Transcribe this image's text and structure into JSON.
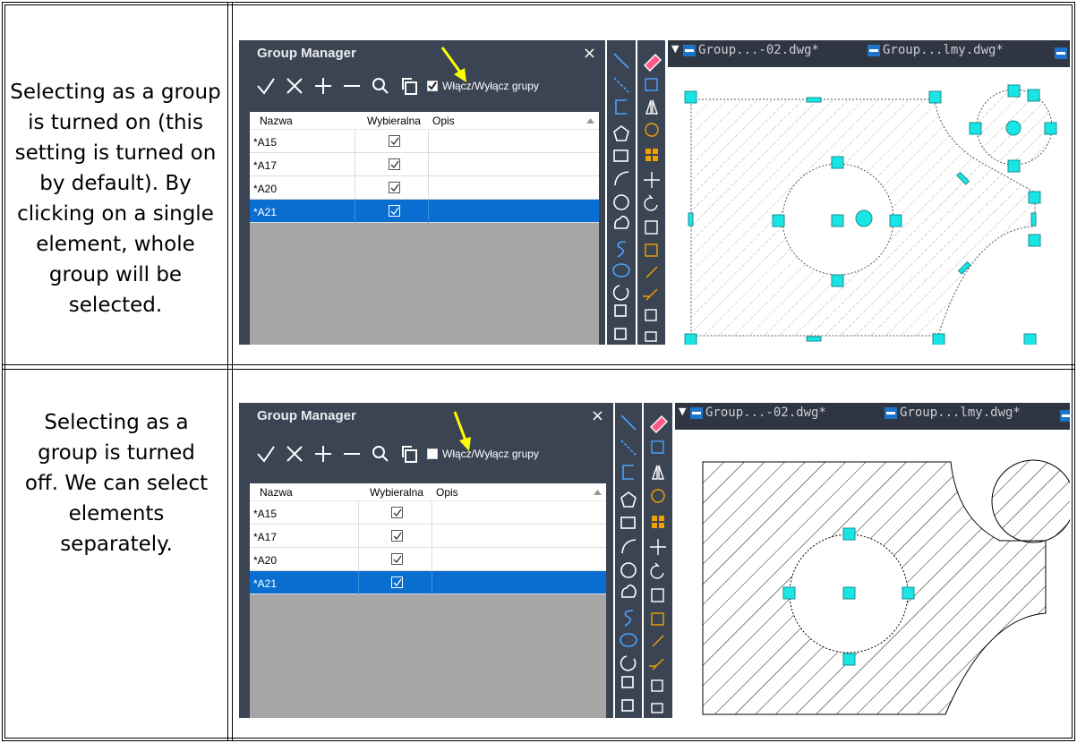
{
  "rows": [
    {
      "description": "Selecting as a group is turned on (this setting is turned on by default). By clicking on a single element, whole group will be selected.",
      "group_manager": {
        "title": "Group Manager",
        "close_label": "×",
        "toggle_label": "Włącz/Wyłącz grupy",
        "toggle_checked": true,
        "columns": [
          "Nazwa",
          "Wybieralna",
          "Opis"
        ],
        "groups": [
          {
            "name": "*A15",
            "selectable": true,
            "selected": false
          },
          {
            "name": "*A17",
            "selectable": true,
            "selected": false
          },
          {
            "name": "*A20",
            "selectable": true,
            "selected": false
          },
          {
            "name": "*A21",
            "selectable": true,
            "selected": true
          }
        ]
      },
      "tabs": [
        "Group...-02.dwg*",
        "Group...lmy.dwg*"
      ]
    },
    {
      "description": "Selecting as a group is turned off. We can select elements separately.",
      "group_manager": {
        "title": "Group Manager",
        "close_label": "×",
        "toggle_label": "Włącz/Wyłącz grupy",
        "toggle_checked": false,
        "columns": [
          "Nazwa",
          "Wybieralna",
          "Opis"
        ],
        "groups": [
          {
            "name": "*A15",
            "selectable": true,
            "selected": false
          },
          {
            "name": "*A17",
            "selectable": true,
            "selected": false
          },
          {
            "name": "*A20",
            "selectable": true,
            "selected": false
          },
          {
            "name": "*A21",
            "selectable": true,
            "selected": true
          }
        ]
      },
      "tabs": [
        "Group...-02.dwg*",
        "Group...lmy.dwg*"
      ]
    }
  ],
  "colors": {
    "panel_bg": "#3b4453",
    "selection_blue": "#0a6ed1",
    "grip_cyan": "#19e5e5",
    "arrow_yellow": "#ffff00"
  },
  "icons": [
    "confirm-check-icon",
    "delete-x-icon",
    "add-plus-icon",
    "remove-minus-icon",
    "search-icon",
    "copy-icon",
    "line-icon",
    "erase-icon",
    "polygon-icon",
    "arc-icon",
    "circle-icon",
    "cloud-icon",
    "spline-icon",
    "ellipse-icon",
    "move-icon",
    "rotate-icon",
    "mirror-icon",
    "extend-icon",
    "trim-icon"
  ]
}
